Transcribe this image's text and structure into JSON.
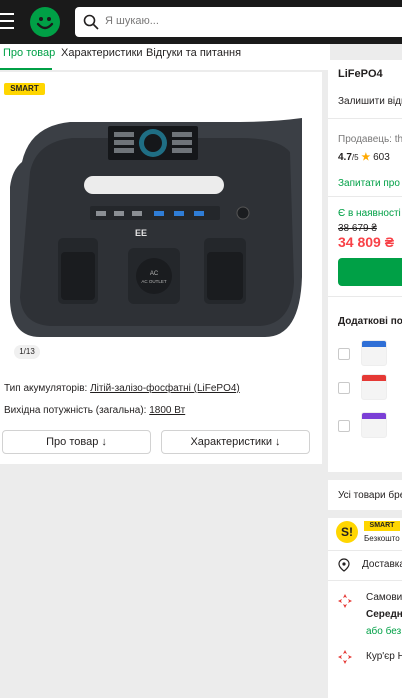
{
  "header": {
    "search_placeholder": "Я шукаю..."
  },
  "tabs": [
    {
      "label": "Про товар"
    },
    {
      "label": "Характеристики"
    },
    {
      "label": "Відгуки та питання"
    }
  ],
  "product": {
    "badge": "SMART",
    "image_counter": "1/13",
    "specs": [
      {
        "label": "Тип акумуляторів: ",
        "value": "Літій-залізо-фосфатні (LiFePO4)"
      },
      {
        "label": "Вихідна потужність (загальна): ",
        "value": "1800 Вт"
      }
    ],
    "buttons": {
      "about": "Про товар ↓",
      "characteristics": "Характеристики ↓"
    },
    "device_labels": {
      "ac_outlet": "AC OUTLET"
    }
  },
  "sidebar": {
    "title_fragment": "LiFePO4",
    "review_link": "Залишити відг",
    "seller": "Продавець: th",
    "rating": "4.7",
    "rating_suffix": "/5",
    "reviews_count": "603",
    "ask_seller": "Запитати про",
    "availability": "Є в наявності",
    "old_price": "38 679 ₴",
    "price": "34 809 ₴",
    "additional": "Додаткові по",
    "all_goods": "Усі товари бре",
    "smart_letter": "S!",
    "smart_label": "SMART",
    "smart_sub": "Безкошто",
    "delivery": "Доставка",
    "pickup": "Самовив",
    "pickup_time": "Середн",
    "pickup_free": "або без",
    "courier": "Кур'єр Н"
  }
}
